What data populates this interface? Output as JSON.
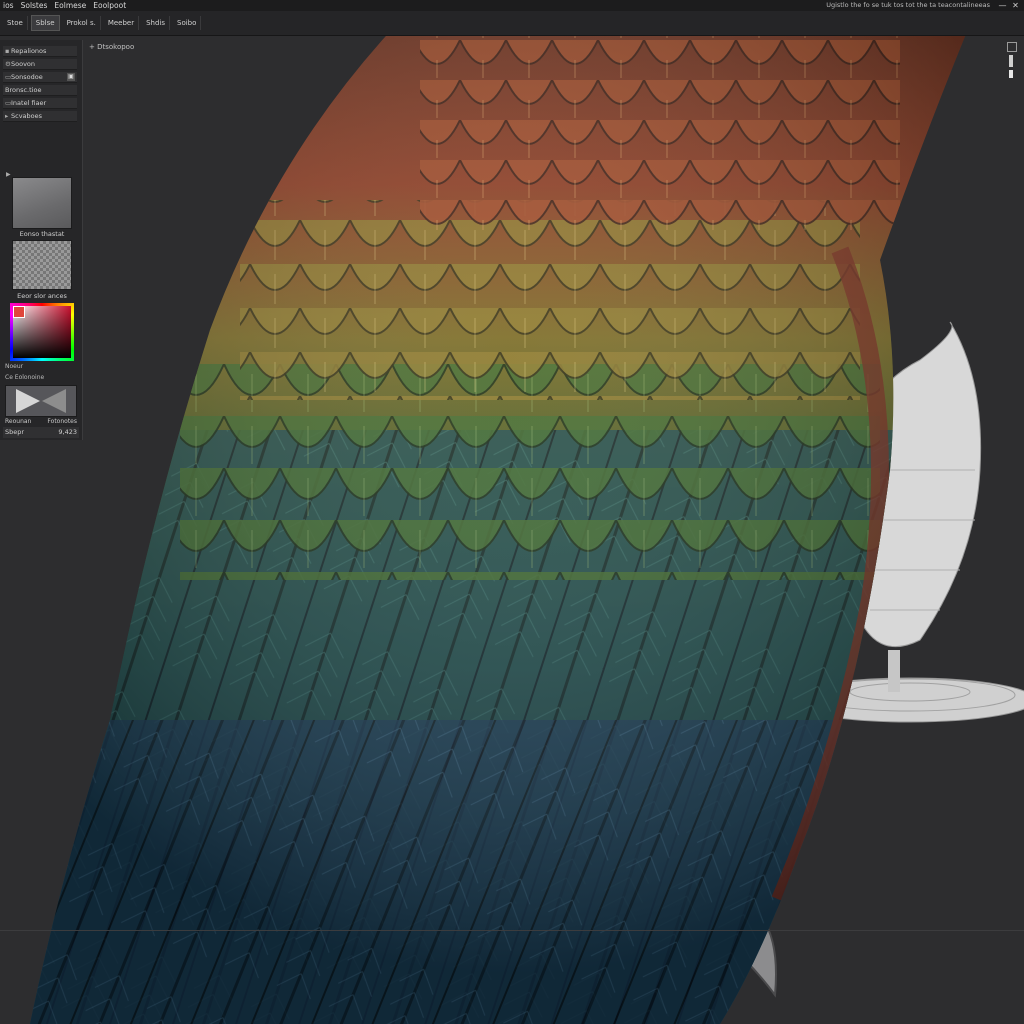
{
  "menubar": {
    "items": [
      "ios",
      "Solstes",
      "Eolmese",
      "Eoolpoot"
    ],
    "right_info": "Ugistlo the fo se tuk tos tot the ta teacontalineeas",
    "controls": [
      "—",
      "✕"
    ]
  },
  "toolbar": {
    "buttons": [
      "Stoe",
      "Sblse",
      "Prokol s.",
      "Meeber",
      "Shdis",
      "Soibo"
    ],
    "active_index": 1
  },
  "left_panel": {
    "rows": [
      {
        "label": "Repalionos"
      },
      {
        "label": "Soovon"
      },
      {
        "label": "Sonsodoe"
      },
      {
        "label": "Bronsc.tioe"
      },
      {
        "label": "Inatel fiaer"
      },
      {
        "label": "Scvaboes"
      }
    ],
    "material_label": "Eonso thastat",
    "texture_label": "Eeor slor ances",
    "noise_label": "Noeur",
    "render_label": "Ce   Eolonoine",
    "render_caption_left": "Reounan",
    "render_caption_right": "Fotonotes",
    "footer_left": "Sbepr",
    "footer_right": "9,423"
  },
  "viewport": {
    "label": "+ Dtsokopoo"
  },
  "colors": {
    "accent": "#e0463c",
    "panel_bg": "#262628",
    "viewport_bg": "#2d2d2f"
  },
  "icons": [
    "triangle-right-icon",
    "window-minimize-icon",
    "window-close-icon",
    "navigation-cube-icon"
  ]
}
